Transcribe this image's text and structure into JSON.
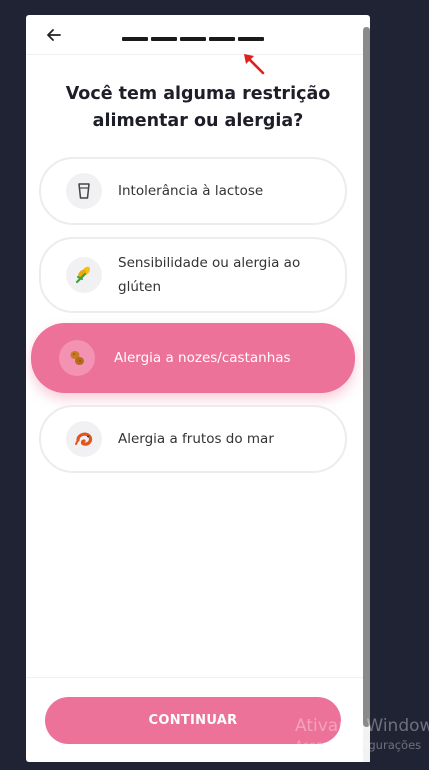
{
  "header": {
    "back_icon": "arrow-left-icon",
    "progress_segments": 5
  },
  "title": "Você tem alguma restrição alimentar ou alergia?",
  "options": [
    {
      "label": "Intolerância à lactose",
      "icon": "milk-glass-icon",
      "selected": false
    },
    {
      "label": "Sensibilidade ou alergia ao glúten",
      "icon": "wheat-icon",
      "selected": false
    },
    {
      "label": "Alergia a nozes/castanhas",
      "icon": "peanut-icon",
      "selected": true
    },
    {
      "label": "Alergia a frutos do mar",
      "icon": "shrimp-icon",
      "selected": false
    }
  ],
  "continue_label": "CONTINUAR",
  "watermark": {
    "line1": "Ativar o Windows",
    "line2": "Acesse Configurações"
  },
  "colors": {
    "accent": "#ec7299",
    "background": "#1f2333",
    "annotation_arrow": "#e0201f"
  }
}
